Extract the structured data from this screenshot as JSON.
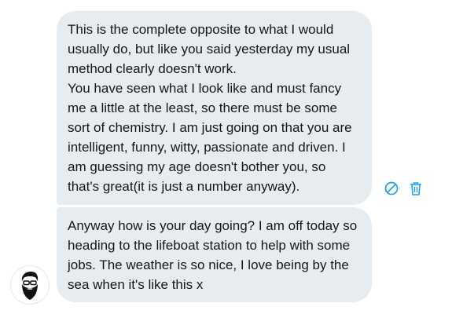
{
  "conversation": {
    "messages": [
      {
        "paragraphs": [
          "This is the complete opposite to what I would usually do, but like you said yesterday my usual method clearly doesn't work.",
          "You have seen what I look like and must fancy me a little at the least, so there must be some sort of chemistry. I am just going on that you are intelligent, funny, witty, passionate and driven. I am guessing my age doesn't bother you, so that's great(it is just a number anyway)."
        ]
      },
      {
        "paragraphs": [
          "Anyway how is your day going? I am off today so heading to the lifeboat station to help with some jobs. The weather is so nice, I love being by the sea when it's like this x"
        ]
      }
    ],
    "message_actions": {
      "icons": [
        "report-icon",
        "delete-icon"
      ]
    },
    "sender": {
      "avatar_icon": "bearded-man-avatar"
    }
  },
  "colors": {
    "bubble_background": "#e6ecf0",
    "text": "#14171a",
    "action_icon": "#1da1f2"
  }
}
